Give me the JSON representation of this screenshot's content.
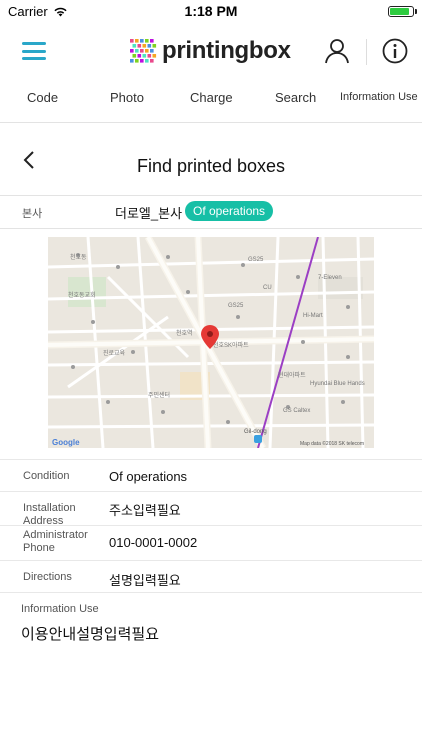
{
  "status_bar": {
    "carrier": "Carrier",
    "time": "1:18 PM",
    "battery_level": 0.95
  },
  "app": {
    "logo_text": "printingbox",
    "menu_icon": "hamburger-menu-icon",
    "user_icon": "user-icon",
    "info_icon": "info-icon"
  },
  "tabs": [
    {
      "label": "Code"
    },
    {
      "label": "Photo"
    },
    {
      "label": "Charge"
    },
    {
      "label": "Search"
    },
    {
      "label": "Information Use"
    }
  ],
  "page": {
    "title": "Find printed boxes"
  },
  "store": {
    "label": "본사",
    "name": "더로엘_본사",
    "status": "Of operations"
  },
  "map": {
    "attribution_logo": "Google",
    "attribution_text": "Map data ©2018 SK telecom",
    "station": "Gil-dong",
    "pin_color": "#e53935",
    "labels": [
      "천호동",
      "천호역",
      "GS25",
      "진로교육",
      "GS25",
      "7-Eleven",
      "천호SK아파트",
      "Hi-Mart",
      "CU",
      "현대아파트",
      "천호동교회",
      "주민센터",
      "Hyundai Blue Hands",
      "GS Caltex"
    ]
  },
  "details": [
    {
      "label": "Condition",
      "value": "Of operations"
    },
    {
      "label": "Installation Address",
      "value": "주소입력필요"
    },
    {
      "label": "Administrator Phone",
      "value": "010-0001-0002"
    },
    {
      "label": "Directions",
      "value": "설명입력필요"
    }
  ],
  "information_use": {
    "label": "Information Use",
    "text": "이용안내설명입력필요"
  },
  "colors": {
    "accent": "#2aa7c9",
    "badge": "#17bfa6"
  }
}
